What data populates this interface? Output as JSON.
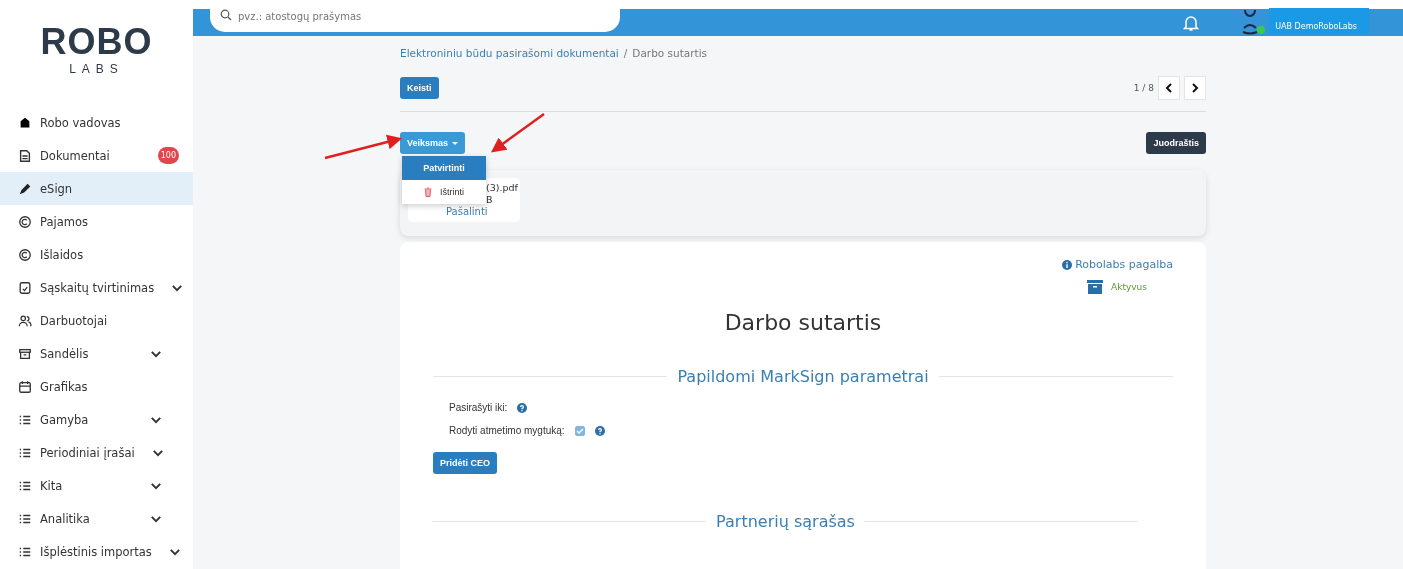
{
  "logo": {
    "title": "ROBO",
    "subtitle": "LABS"
  },
  "search": {
    "placeholder": "pvz.: atostogų prašymas"
  },
  "user": {
    "name": "UAB DemoRoboLabs",
    "online": true
  },
  "sidebar": {
    "items": [
      {
        "label": "Robo vadovas",
        "selected": false,
        "expandable": false
      },
      {
        "label": "Dokumentai",
        "selected": false,
        "expandable": false,
        "badge": "100"
      },
      {
        "label": "eSign",
        "selected": true,
        "expandable": false
      },
      {
        "label": "Pajamos",
        "selected": false,
        "expandable": false
      },
      {
        "label": "Išlaidos",
        "selected": false,
        "expandable": false
      },
      {
        "label": "Sąskaitų tvirtinimas",
        "selected": false,
        "expandable": true
      },
      {
        "label": "Darbuotojai",
        "selected": false,
        "expandable": false
      },
      {
        "label": "Sandėlis",
        "selected": false,
        "expandable": true
      },
      {
        "label": "Grafikas",
        "selected": false,
        "expandable": false
      },
      {
        "label": "Gamyba",
        "selected": false,
        "expandable": true
      },
      {
        "label": "Periodiniai įrašai",
        "selected": false,
        "expandable": true
      },
      {
        "label": "Kita",
        "selected": false,
        "expandable": true
      },
      {
        "label": "Analitika",
        "selected": false,
        "expandable": true
      },
      {
        "label": "Išplėstinis importas",
        "selected": false,
        "expandable": true
      }
    ]
  },
  "breadcrumb": [
    "Elektroniniu būdu pasirašomi dokumentai",
    "/",
    "Darbo sutartis"
  ],
  "edit_button": "Keisti",
  "pager": {
    "text": "1 / 8"
  },
  "action_button": "Veiksmas",
  "action_menu": [
    {
      "label": "Patvirtinti",
      "selected": true,
      "kind": "plain"
    },
    {
      "label": "Ištrinti",
      "selected": false,
      "kind": "delete"
    }
  ],
  "status_button": "Juodraštis",
  "attachment": {
    "name": "(3).pdf",
    "size": "B",
    "remove": "Pašalinti"
  },
  "document": {
    "help_link": "Robolabs pagalba",
    "state": "Aktyvus",
    "title": "Darbo sutartis",
    "section": "Papildomi MarkSign parametrai",
    "fields": [
      {
        "label": "Pasirašyti iki:",
        "kind": "help"
      },
      {
        "label": "Rodyti atmetimo mygtuką:",
        "kind": "checkbox",
        "checked": true
      }
    ],
    "add_button": "Pridėti CEO",
    "partners": "Partnerių sąrašas"
  }
}
